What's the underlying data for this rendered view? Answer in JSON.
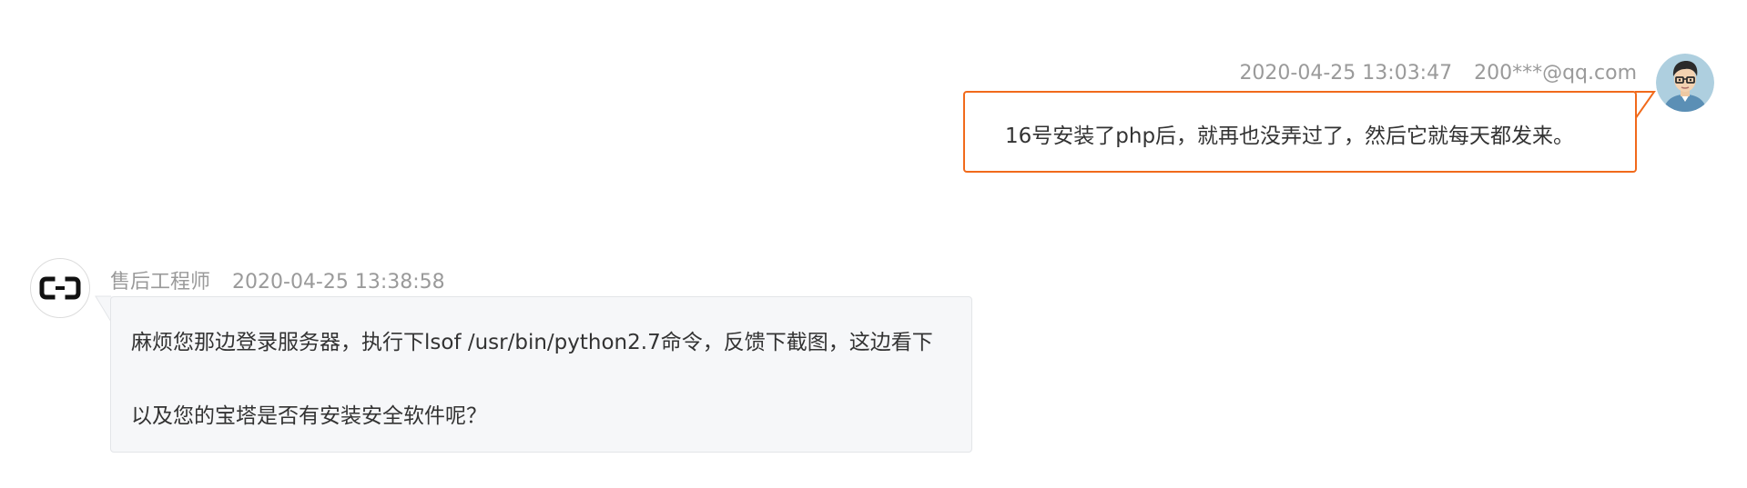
{
  "conversation": {
    "customer_message": {
      "timestamp": "2020-04-25 13:03:47",
      "sender": "200***@qq.com",
      "text": "16号安装了php后，就再也没弄过了，然后它就每天都发来。",
      "avatar_icon": "user-avatar-icon",
      "border_color": "#f16a1b"
    },
    "engineer_message": {
      "sender": "售后工程师",
      "timestamp": "2020-04-25 13:38:58",
      "lines": [
        "麻烦您那边登录服务器，执行下lsof  /usr/bin/python2.7命令，反馈下截图，这边看下",
        "以及您的宝塔是否有安装安全软件呢？"
      ],
      "avatar_icon": "aliyun-logo-icon",
      "bubble_background": "#f6f7f9"
    }
  }
}
